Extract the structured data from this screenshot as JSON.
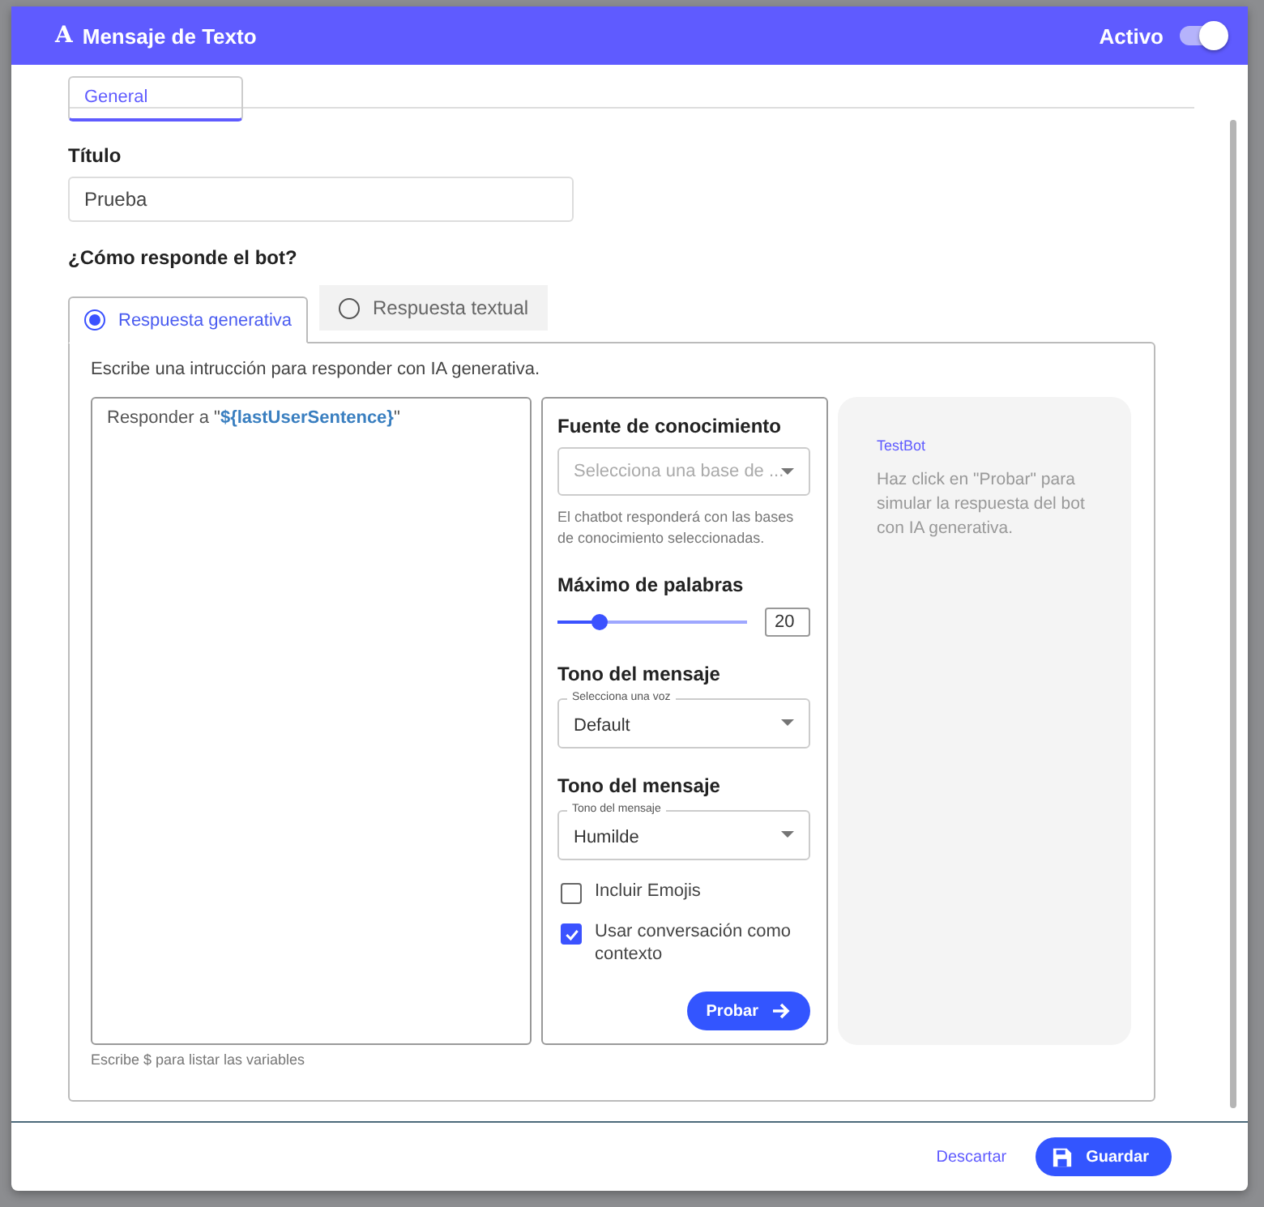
{
  "header": {
    "icon": "A",
    "title": "Mensaje de Texto",
    "active_label": "Activo",
    "active_on": true
  },
  "tabs": [
    {
      "label": "General",
      "selected": true
    }
  ],
  "title_field": {
    "label": "Título",
    "value": "Prueba"
  },
  "question": "¿Cómo responde el bot?",
  "response_tabs": [
    {
      "label": "Respuesta generativa",
      "selected": true
    },
    {
      "label": "Respuesta textual",
      "selected": false
    }
  ],
  "instruction": "Escribe una intrucción para responder con IA generativa.",
  "prompt": {
    "value": "Responder a \"**${lastUserSentence}**\"",
    "hint": "Escribe $ para listar las variables"
  },
  "knowledge": {
    "heading": "Fuente de conocimiento",
    "placeholder": "Selecciona una base de ...",
    "help": "El chatbot responderá con las bases de conocimiento seleccionadas."
  },
  "max_words": {
    "heading": "Máximo de palabras",
    "level": 0.22,
    "value": "20"
  },
  "selects": [
    {
      "heading": "Tono del mensaje",
      "legend": "Selecciona una voz",
      "value": "Default"
    },
    {
      "heading": "Tono del mensaje",
      "legend": "Tono del mensaje",
      "value": "Humilde"
    }
  ],
  "options": [
    {
      "label": "Incluir Emojis",
      "checked": false
    },
    {
      "label": "Usar conversación como contexto",
      "checked": true
    }
  ],
  "test_button": "Probar",
  "testbot": {
    "title": "TestBot",
    "message": "Haz click en \"Probar\" para simular la respuesta del bot con IA generativa."
  },
  "footer": {
    "cancel": "Descartar",
    "save": "Guardar"
  }
}
